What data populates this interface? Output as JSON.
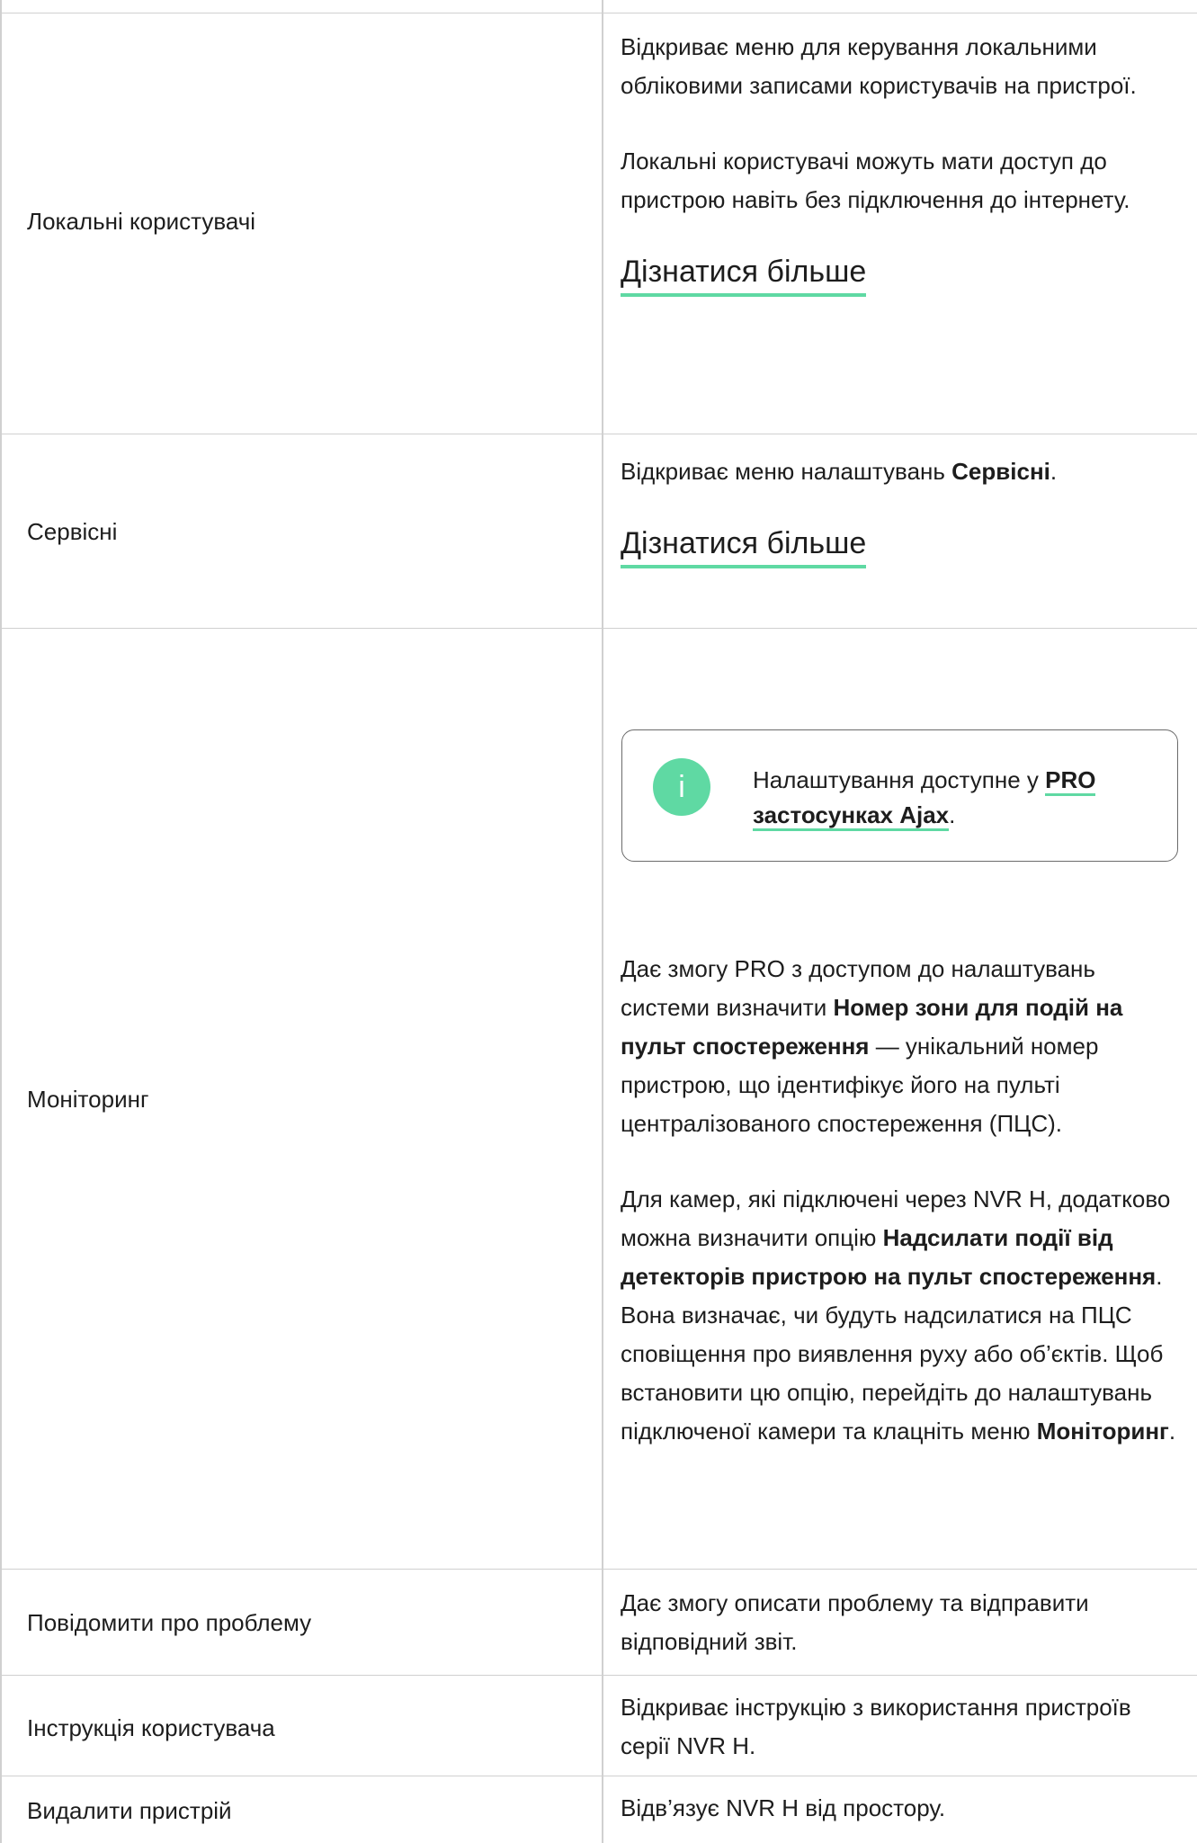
{
  "rows": [
    {
      "label": "Локальні користувачі",
      "p1": "Відкриває меню для керування локальними обліковими записами користувачів на пристрої.",
      "p2": "Локальні користувачі можуть мати доступ до пристрою навіть без підключення до інтернету.",
      "link": "Дізнатися більше"
    },
    {
      "label": "Сервісні",
      "p1_prefix": "Відкриває меню налаштувань ",
      "p1_bold": "Сервісні",
      "p1_suffix": ".",
      "link": "Дізнатися більше"
    },
    {
      "label": "Моніторинг",
      "note": {
        "icon": "info-icon",
        "text_prefix": "Налаштування доступне у ",
        "link": "PRO застосунках Ajax",
        "text_suffix": "."
      },
      "p1_prefix": "Дає змогу PRO з доступом до налаштувань системи визначити ",
      "p1_bold": "Номер зони для подій на пульт спостереження",
      "p1_suffix": " — унікальний номер пристрою, що ідентифікує його на пульті централізованого спостереження (ПЦС).",
      "p2_prefix": "Для камер, які підключені через NVR H, додатково можна визначити опцію ",
      "p2_bold": "Надсилати події від детекторів пристрою на пульт спостереження",
      "p2_middle": ". Вона визначає, чи будуть надсилатися на ПЦС сповіщення про виявлення руху або об’єктів. Щоб встановити цю опцію, перейдіть до налаштувань підключеної камери та клацніть меню ",
      "p2_bold2": "Моніторинг",
      "p2_suffix": "."
    },
    {
      "label": "Повідомити про проблему",
      "p1": "Дає змогу описати проблему та відправити відповідний звіт."
    },
    {
      "label": "Інструкція користувача",
      "p1": "Відкриває інструкцію з використання пристроїв серії NVR H."
    },
    {
      "label": "Видалити пристрій",
      "p1": "Відв’язує NVR H від простору."
    }
  ],
  "colors": {
    "accent": "#5fd9a3",
    "border": "#d0d0d0",
    "text": "#1d1d1d"
  }
}
